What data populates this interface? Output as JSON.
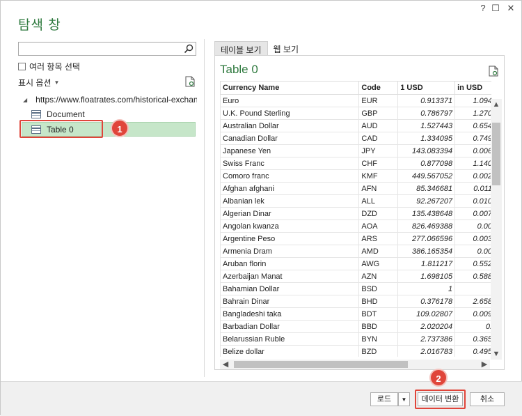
{
  "window": {
    "title": "탐색 창"
  },
  "left_panel": {
    "search_placeholder": "",
    "multi_select_label": "여러 항목 선택",
    "display_options_label": "표시 옵션",
    "tree": {
      "root_label": "https://www.floatrates.com/historical-exchang...",
      "items": [
        {
          "label": "Document"
        },
        {
          "label": "Table 0"
        }
      ]
    }
  },
  "annotations": {
    "badge1": "1",
    "badge2": "2"
  },
  "right_panel": {
    "tabs": [
      {
        "label": "테이블 보기"
      },
      {
        "label": "웹 보기"
      }
    ],
    "preview_title": "Table 0",
    "columns": [
      "Currency Name",
      "Code",
      "1 USD",
      "in USD"
    ],
    "rows": [
      [
        "Euro",
        "EUR",
        "0.913371",
        "1.094"
      ],
      [
        "U.K. Pound Sterling",
        "GBP",
        "0.786797",
        "1.270"
      ],
      [
        "Australian Dollar",
        "AUD",
        "1.527443",
        "0.654"
      ],
      [
        "Canadian Dollar",
        "CAD",
        "1.334095",
        "0.749"
      ],
      [
        "Japanese Yen",
        "JPY",
        "143.083394",
        "0.006"
      ],
      [
        "Swiss Franc",
        "CHF",
        "0.877098",
        "1.140"
      ],
      [
        "Comoro franc",
        "KMF",
        "449.567052",
        "0.002"
      ],
      [
        "Afghan afghani",
        "AFN",
        "85.346681",
        "0.011"
      ],
      [
        "Albanian lek",
        "ALL",
        "92.267207",
        "0.010"
      ],
      [
        "Algerian Dinar",
        "DZD",
        "135.438648",
        "0.007"
      ],
      [
        "Angolan kwanza",
        "AOA",
        "826.469388",
        "0.00"
      ],
      [
        "Argentine Peso",
        "ARS",
        "277.066596",
        "0.003"
      ],
      [
        "Armenia Dram",
        "AMD",
        "386.165354",
        "0.00"
      ],
      [
        "Aruban florin",
        "AWG",
        "1.811217",
        "0.552"
      ],
      [
        "Azerbaijan Manat",
        "AZN",
        "1.698105",
        "0.588"
      ],
      [
        "Bahamian Dollar",
        "BSD",
        "1",
        ""
      ],
      [
        "Bahrain Dinar",
        "BHD",
        "0.376178",
        "2.658"
      ],
      [
        "Bangladeshi taka",
        "BDT",
        "109.02807",
        "0.009"
      ],
      [
        "Barbadian Dollar",
        "BBD",
        "2.020204",
        "0."
      ],
      [
        "Belarussian Ruble",
        "BYN",
        "2.737386",
        "0.365"
      ],
      [
        "Belize dollar",
        "BZD",
        "2.016783",
        "0.495"
      ]
    ]
  },
  "footer": {
    "load_label": "로드",
    "transform_label": "데이터 변환",
    "cancel_label": "취소"
  }
}
